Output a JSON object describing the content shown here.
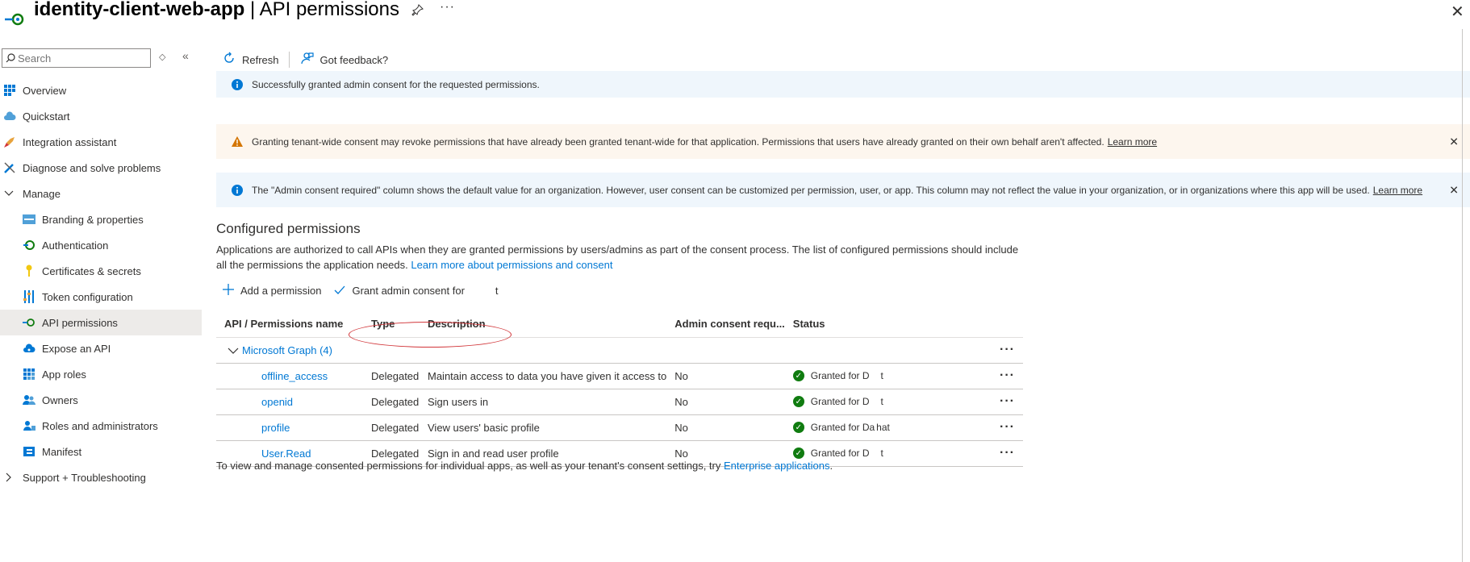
{
  "header": {
    "app_name": "identity-client-web-app",
    "separator": " | ",
    "page_name": "API permissions",
    "pin_icon": "pin-icon",
    "more_icon": "more-icon",
    "close_icon": "close-icon"
  },
  "sidebar": {
    "search_placeholder": "Search",
    "items": [
      {
        "label": "Overview",
        "icon": "grid-icon",
        "level": "top"
      },
      {
        "label": "Quickstart",
        "icon": "cloud-icon",
        "level": "top"
      },
      {
        "label": "Integration assistant",
        "icon": "rocket-icon",
        "level": "top"
      },
      {
        "label": "Diagnose and solve problems",
        "icon": "wrench-icon",
        "level": "top"
      },
      {
        "label": "Manage",
        "icon": "chevron-down-icon",
        "level": "group"
      },
      {
        "label": "Branding & properties",
        "icon": "branding-icon",
        "level": "sub"
      },
      {
        "label": "Authentication",
        "icon": "authentication-icon",
        "level": "sub"
      },
      {
        "label": "Certificates & secrets",
        "icon": "key-icon",
        "level": "sub"
      },
      {
        "label": "Token configuration",
        "icon": "token-icon",
        "level": "sub"
      },
      {
        "label": "API permissions",
        "icon": "api-permissions-icon",
        "level": "sub",
        "active": true
      },
      {
        "label": "Expose an API",
        "icon": "cloud-api-icon",
        "level": "sub"
      },
      {
        "label": "App roles",
        "icon": "app-roles-icon",
        "level": "sub"
      },
      {
        "label": "Owners",
        "icon": "owners-icon",
        "level": "sub"
      },
      {
        "label": "Roles and administrators",
        "icon": "roles-icon",
        "level": "sub"
      },
      {
        "label": "Manifest",
        "icon": "manifest-icon",
        "level": "sub"
      },
      {
        "label": "Support + Troubleshooting",
        "icon": "chevron-right-icon",
        "level": "group"
      }
    ]
  },
  "toolbar": {
    "refresh_label": "Refresh",
    "feedback_label": "Got feedback?"
  },
  "banners": {
    "success_text": "Successfully granted admin consent for the requested permissions.",
    "warning_text": "Granting tenant-wide consent may revoke permissions that have already been granted tenant-wide for that application. Permissions that users have already granted on their own behalf aren't affected.",
    "warning_link": "Learn more",
    "info_text": "The \"Admin consent required\" column shows the default value for an organization. However, user consent can be customized per permission, user, or app. This column may not reflect the value in your organization, or in organizations where this app will be used.",
    "info_link": "Learn more",
    "colors": {
      "info_bg": "#eff6fc",
      "warning_bg": "#fdf6ee",
      "info_icon": "#0078d4",
      "warning_icon": "#d47500"
    }
  },
  "configured": {
    "title": "Configured permissions",
    "description": "Applications are authorized to call APIs when they are granted permissions by users/admins as part of the consent process. The list of configured permissions should include all the permissions the application needs.",
    "description_link": "Learn more about permissions and consent",
    "add_permission_label": "Add a permission",
    "grant_consent_label": "Grant admin consent for",
    "grant_consent_suffix": "t",
    "columns": [
      "API / Permissions name",
      "Type",
      "Description",
      "Admin consent requ...",
      "Status"
    ],
    "group": "Microsoft Graph (4)",
    "rows": [
      {
        "name": "offline_access",
        "type": "Delegated",
        "description": "Maintain access to data you have given it access to",
        "admin_consent": "No",
        "status": "Granted for D",
        "status_tail": "t"
      },
      {
        "name": "openid",
        "type": "Delegated",
        "description": "Sign users in",
        "admin_consent": "No",
        "status": "Granted for D",
        "status_tail": "t"
      },
      {
        "name": "profile",
        "type": "Delegated",
        "description": "View users' basic profile",
        "admin_consent": "No",
        "status": "Granted for Da",
        "status_tail": "hat"
      },
      {
        "name": "User.Read",
        "type": "Delegated",
        "description": "Sign in and read user profile",
        "admin_consent": "No",
        "status": "Granted for D",
        "status_tail": "t"
      }
    ],
    "footer_text": "To view and manage consented permissions for individual apps, as well as your tenant's consent settings, try",
    "footer_link": "Enterprise applications",
    "footer_end": "."
  }
}
